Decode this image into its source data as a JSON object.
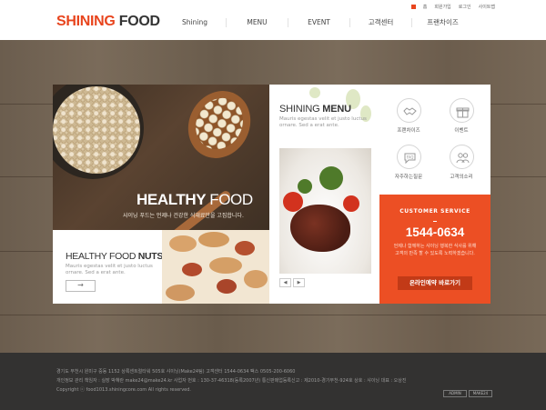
{
  "header": {
    "logo_part1": "SHINING",
    "logo_part2": "FOOD",
    "util_links": [
      "홈",
      "회원가입",
      "로그인",
      "사이트맵"
    ],
    "nav": [
      "Shining",
      "MENU",
      "EVENT",
      "고객센터",
      "프랜차이즈"
    ]
  },
  "hero": {
    "title_bold": "HEALTHY",
    "title_light": "FOOD",
    "subtitle": "샤이닝 푸드는 언제나 건강한 식재료만을 고집합니다."
  },
  "nuts": {
    "title_light": "HEALTHY FOOD",
    "title_bold": "NUTS",
    "desc": "Mauris egestas velit et justo luctus ornare. Sed a erat ante.",
    "more_button": "→"
  },
  "menu": {
    "title_light": "SHINING",
    "title_bold": "MENU",
    "desc": "Mauris egestas velit et justo luctus ornare. Sed a erat ante.",
    "prev": "◀",
    "next": "▶"
  },
  "quick": {
    "items": [
      {
        "label": "프랜차이즈",
        "icon": "handshake-icon"
      },
      {
        "label": "이벤트",
        "icon": "gift-icon"
      },
      {
        "label": "자주하는질문",
        "icon": "faq-icon"
      },
      {
        "label": "고객의소리",
        "icon": "people-icon"
      }
    ]
  },
  "cs": {
    "title": "CUSTOMER SERVICE",
    "phone": "1544-0634",
    "desc": "언제나 함께하는 샤이닝 행복한 식사를 위해 고객의 만족 할 수 있도록 노력하겠습니다.",
    "button": "온라인예약 바로가기"
  },
  "footer": {
    "line1": "경기도 부천시 원미구 중동 1152 상록센트럴타워 505호 샤이닝(Make24팀) 고객센터 1544-0634 팩스 0505-200-6060",
    "line2": "개인정보 관리 책임자 : 실장 박혜란 make24@make24.kr 사업자 번호 : 130-37-46318(등록2007년) 통신판매업등록신고 : 제2010-경기부천-924호 상호 : 샤이닝 대표 : 오상진",
    "line3": "Copyright ⓒ food1013.shiningcore.com All rights reserved.",
    "badges": [
      "ADMIN",
      "MAKE24"
    ]
  },
  "colors": {
    "accent": "#e8451e",
    "cs_background": "#ec4f24",
    "footer_background": "#333231"
  }
}
